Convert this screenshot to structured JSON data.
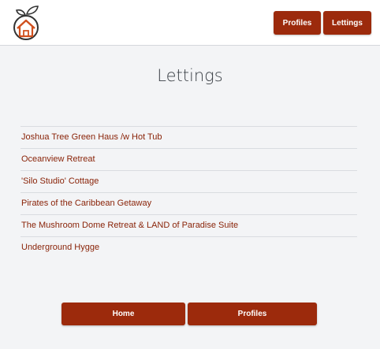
{
  "header": {
    "logo_icon": "house-with-leaves-icon",
    "nav": [
      {
        "label": "Profiles"
      },
      {
        "label": "Lettings"
      }
    ]
  },
  "page": {
    "title": "Lettings"
  },
  "lettings": [
    {
      "name": "Joshua Tree Green Haus /w Hot Tub"
    },
    {
      "name": "Oceanview Retreat"
    },
    {
      "name": "'Silo Studio' Cottage"
    },
    {
      "name": "Pirates of the Caribbean Getaway"
    },
    {
      "name": "The Mushroom Dome Retreat & LAND of Paradise Suite"
    },
    {
      "name": "Underground Hygge"
    }
  ],
  "footer": {
    "home_label": "Home",
    "profiles_label": "Profiles"
  },
  "colors": {
    "accent": "#9c2a0c",
    "link": "#8a2409",
    "background": "#f3f4f6"
  }
}
